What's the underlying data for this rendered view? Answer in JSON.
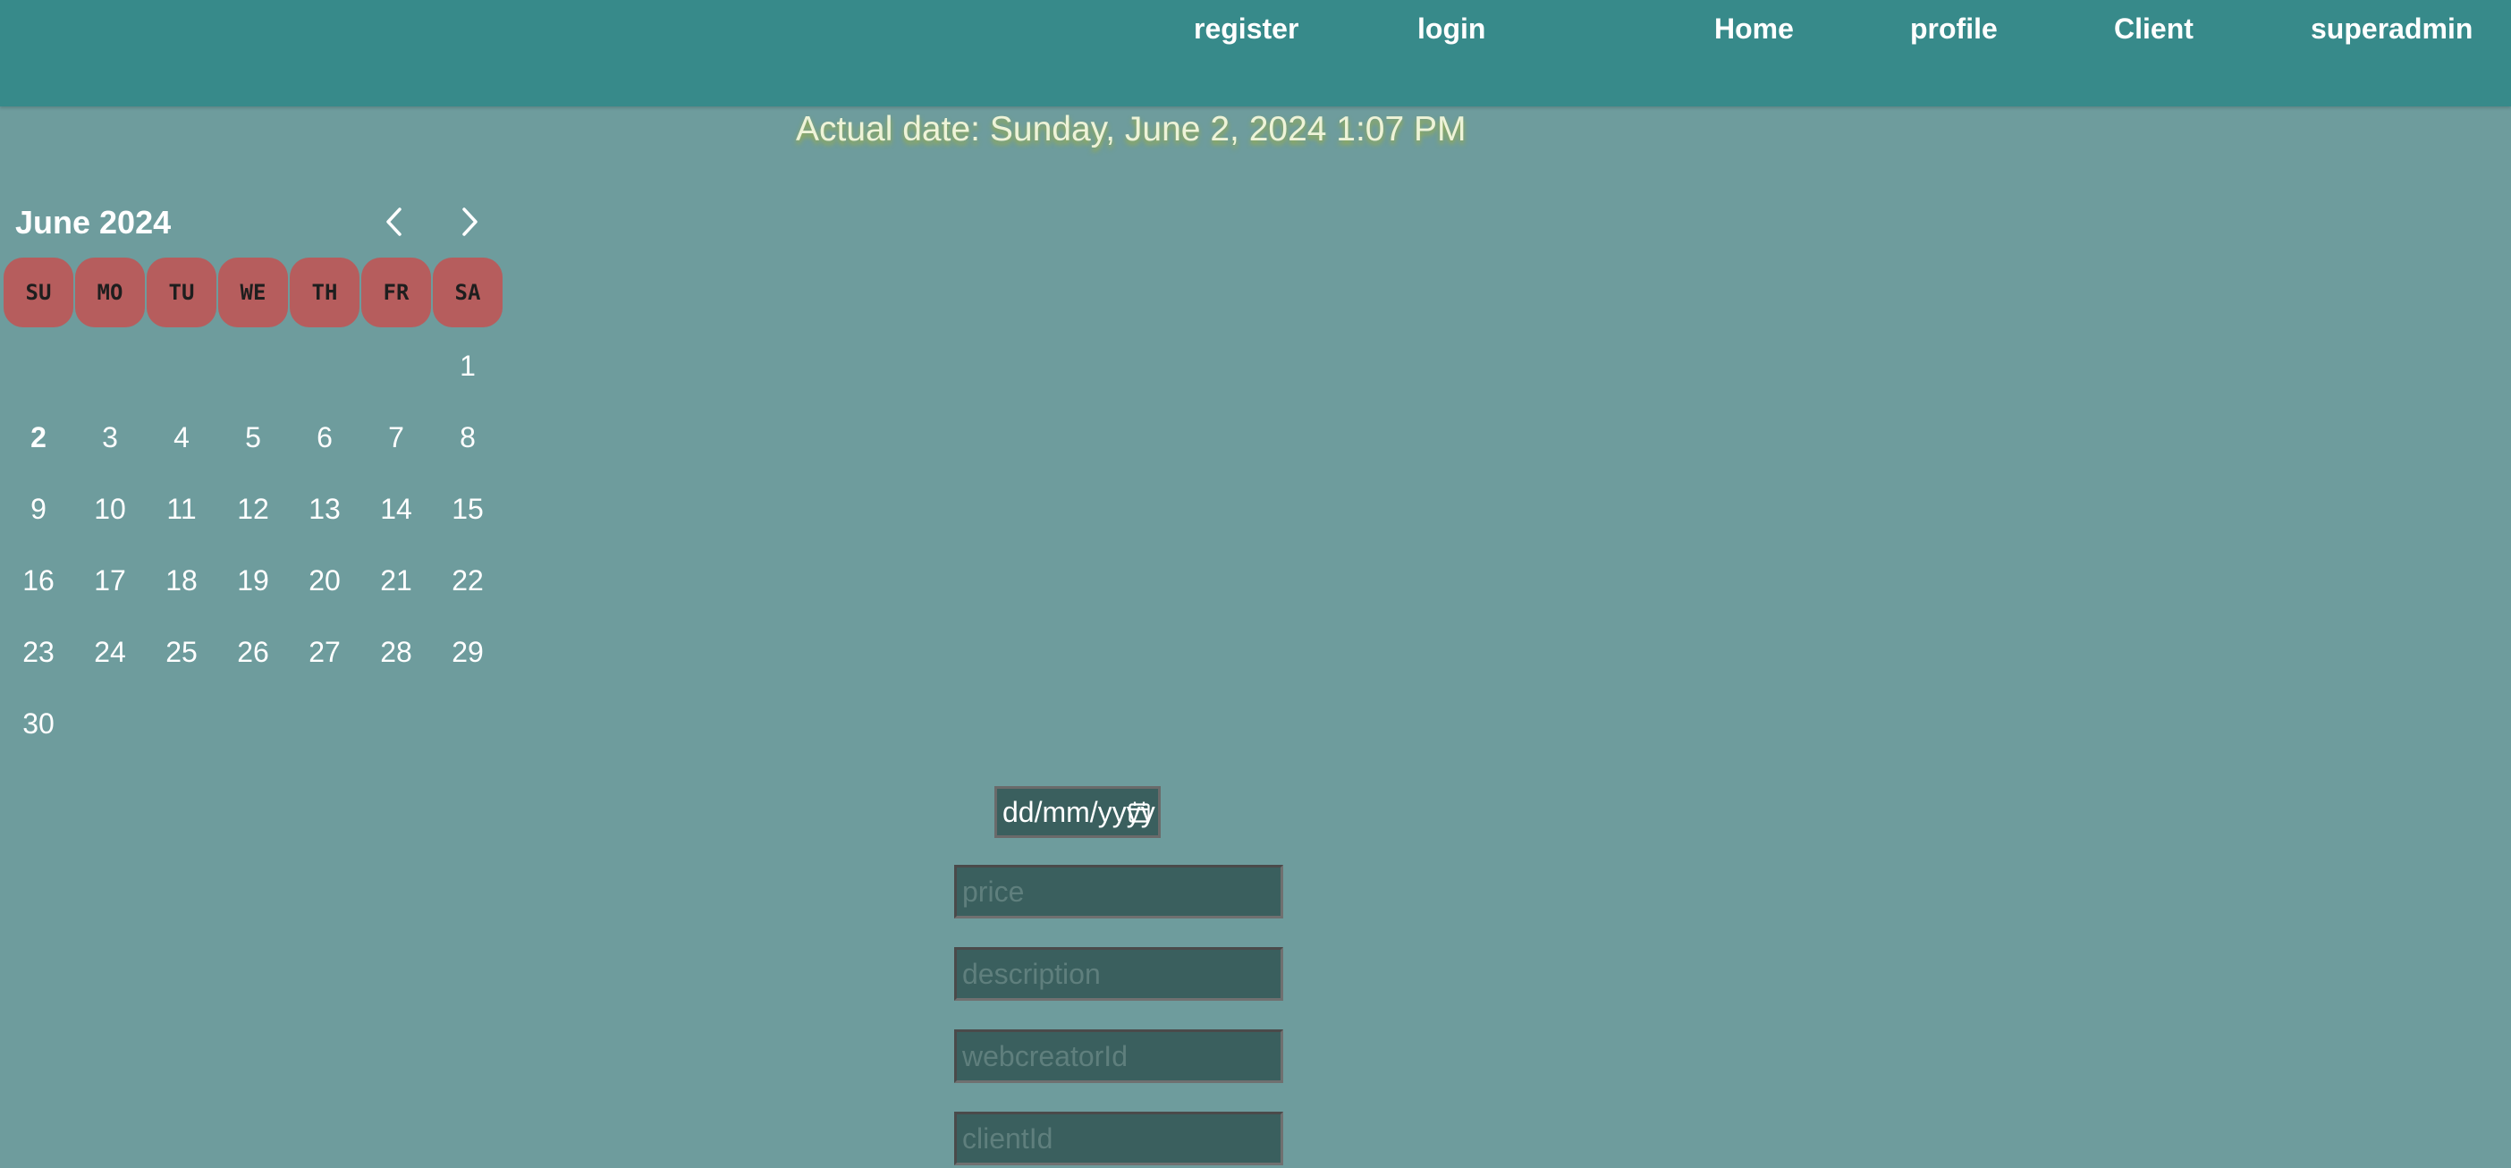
{
  "nav": {
    "register": "register",
    "login": "login",
    "home": "Home",
    "profile": "profile",
    "client": "Client",
    "superadmin": "superadmin"
  },
  "actual_date": {
    "prefix": "Actual date:",
    "value": "Sunday, June 2, 2024 1:07 PM"
  },
  "calendar": {
    "month_label": "June 2024",
    "prev_icon": "chevron-left-icon",
    "next_icon": "chevron-right-icon",
    "weekdays": [
      "SU",
      "MO",
      "TU",
      "WE",
      "TH",
      "FR",
      "SA"
    ],
    "weeks": [
      [
        "",
        "",
        "",
        "",
        "",
        "",
        "1"
      ],
      [
        "2",
        "3",
        "4",
        "5",
        "6",
        "7",
        "8"
      ],
      [
        "9",
        "10",
        "11",
        "12",
        "13",
        "14",
        "15"
      ],
      [
        "16",
        "17",
        "18",
        "19",
        "20",
        "21",
        "22"
      ],
      [
        "23",
        "24",
        "25",
        "26",
        "27",
        "28",
        "29"
      ],
      [
        "30",
        "",
        "",
        "",
        "",
        "",
        ""
      ]
    ],
    "selected_day": "2"
  },
  "form": {
    "date": {
      "placeholder": "dd/mm/yyyy",
      "icon": "calendar-icon"
    },
    "price": {
      "placeholder": "price",
      "value": ""
    },
    "description": {
      "placeholder": "description",
      "value": ""
    },
    "webcreatorId": {
      "placeholder": "webcreatorId",
      "value": ""
    },
    "clientId": {
      "placeholder": "clientId",
      "value": ""
    }
  },
  "colors": {
    "page_background": "#6e9c9d",
    "navbar": "#378a8a",
    "weekday_chip": "#b65d5d",
    "input_background": "#3a5f5e"
  }
}
